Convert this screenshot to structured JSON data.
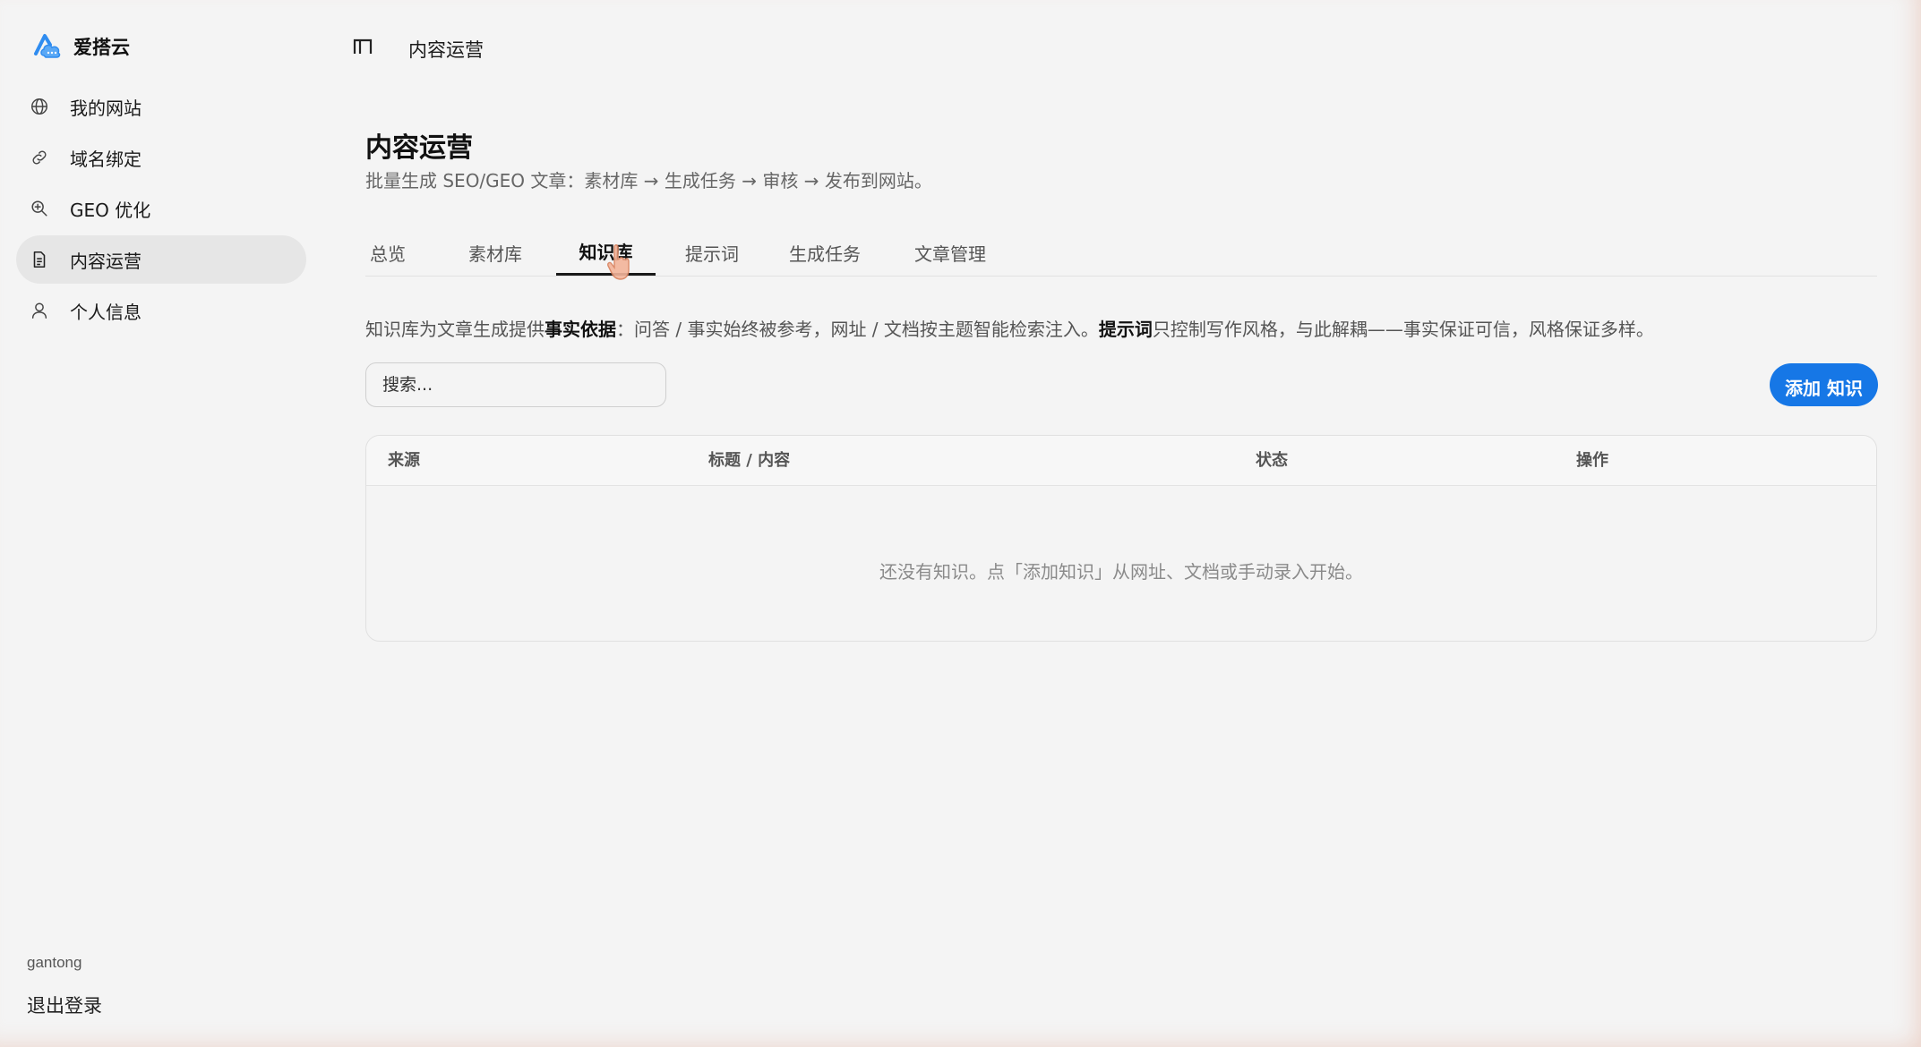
{
  "app": {
    "brand_name": "爱搭云"
  },
  "sidebar": {
    "items": [
      {
        "label": "我的网站",
        "icon": "globe-icon"
      },
      {
        "label": "域名绑定",
        "icon": "link-icon"
      },
      {
        "label": "GEO 优化",
        "icon": "zoom-search-icon"
      },
      {
        "label": "内容运营",
        "icon": "document-icon",
        "active": true
      },
      {
        "label": "个人信息",
        "icon": "user-icon"
      }
    ],
    "user_name": "gantong",
    "logout_label": "退出登录"
  },
  "topbar": {
    "title": "内容运营"
  },
  "page": {
    "title": "内容运营",
    "subtitle": "批量生成 SEO/GEO 文章：素材库 → 生成任务 → 审核 → 发布到网站。"
  },
  "tabs": [
    {
      "label": "总览"
    },
    {
      "label": "素材库"
    },
    {
      "label": "知识库",
      "active": true
    },
    {
      "label": "提示词"
    },
    {
      "label": "生成任务"
    },
    {
      "label": "文章管理"
    }
  ],
  "intro": {
    "part1": "知识库为文章生成提供",
    "bold1": "事实依据",
    "part2": "：问答 / 事实始终被参考，网址 / 文档按主题智能检索注入。",
    "bold2": "提示词",
    "part3": "只控制写作风格，与此解耦——事实保证可信，风格保证多样。"
  },
  "search": {
    "placeholder": "搜索..."
  },
  "add_button_label": "添加 知识",
  "table": {
    "columns": [
      "来源",
      "标题 / 内容",
      "状态",
      "操作"
    ],
    "empty_text": "还没有知识。点「添加知识」从网址、文档或手动录入开始。"
  },
  "colors": {
    "background": "#f4f4f4",
    "accent": "#1677e6",
    "active_nav_bg": "#e6e6e6"
  }
}
